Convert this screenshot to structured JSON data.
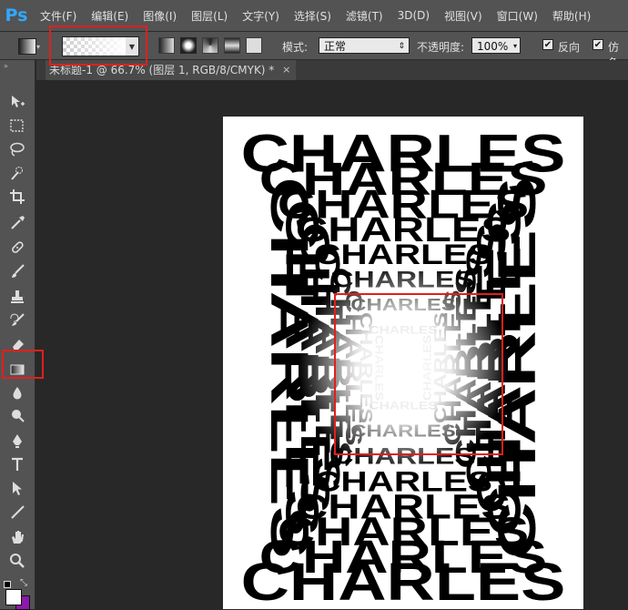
{
  "app": {
    "logo": "Ps"
  },
  "menu": [
    "文件(F)",
    "编辑(E)",
    "图像(I)",
    "图层(L)",
    "文字(Y)",
    "选择(S)",
    "滤镜(T)",
    "3D(D)",
    "视图(V)",
    "窗口(W)",
    "帮助(H)"
  ],
  "options": {
    "mode_label": "模式:",
    "mode_value": "正常",
    "opacity_label": "不透明度:",
    "opacity_value": "100%",
    "reverse_label": "反向",
    "dither_label": "仿色",
    "reverse_checked": true,
    "dither_checked": true
  },
  "document": {
    "tab_title": "未标题-1 @ 66.7% (图层 1, RGB/8/CMYK) *",
    "close": "×",
    "artwork_word": "CHARLES"
  },
  "tools": [
    "move-icon",
    "marquee-icon",
    "lasso-icon",
    "quick-select-icon",
    "crop-icon",
    "eyedropper-icon",
    "healing-icon",
    "brush-icon",
    "stamp-icon",
    "history-brush-icon",
    "eraser-icon",
    "gradient-icon",
    "blur-icon",
    "dodge-icon",
    "pen-icon",
    "type-icon",
    "path-select-icon",
    "line-icon",
    "hand-icon",
    "zoom-icon"
  ],
  "colors": {
    "highlight": "#e0201c",
    "foreground": "#ffffff",
    "background": "#8a1aa8"
  }
}
